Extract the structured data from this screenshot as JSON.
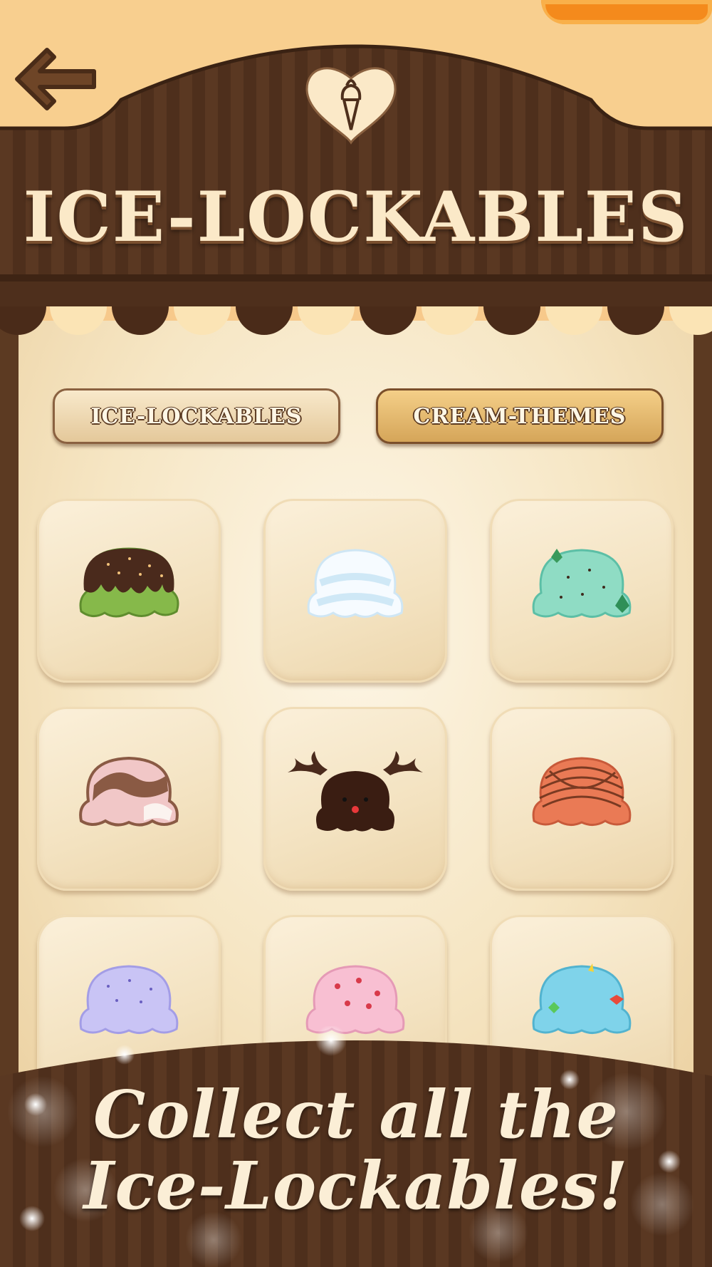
{
  "header": {
    "title": "ICE-LOCKABLES",
    "back_icon": "back-arrow-icon",
    "emblem_icon": "ice-cream-heart-icon"
  },
  "tabs": [
    {
      "label": "ICE-LOCKABLES",
      "selected": true
    },
    {
      "label": "CREAM-THEMES",
      "selected": false
    }
  ],
  "items": [
    {
      "name": "chocolate-matcha-scoop",
      "colors": [
        "#4a2a1c",
        "#86b94a"
      ]
    },
    {
      "name": "vanilla-cloud-scoop",
      "colors": [
        "#f6fbff",
        "#bfe0f2"
      ]
    },
    {
      "name": "mint-chip-scoop",
      "colors": [
        "#8fdcc4",
        "#2f8f57"
      ]
    },
    {
      "name": "neapolitan-swirl-scoop",
      "colors": [
        "#f1c7c7",
        "#8a5a44"
      ]
    },
    {
      "name": "reindeer-chocolate-scoop",
      "colors": [
        "#3a1d12",
        "#5a3620"
      ]
    },
    {
      "name": "orange-chocolate-drizzle-scoop",
      "colors": [
        "#ea7a55",
        "#7a3a22"
      ]
    },
    {
      "name": "lavender-sprinkle-scoop",
      "colors": [
        "#c9c4f5",
        "#6a5fc0"
      ]
    },
    {
      "name": "strawberry-sprinkle-scoop",
      "colors": [
        "#f8bfd2",
        "#d83a4a"
      ]
    },
    {
      "name": "blue-candy-scoop",
      "colors": [
        "#7fd3ea",
        "#e84a3a"
      ]
    }
  ],
  "caption": {
    "line1": "Collect all the",
    "line2": "Ice-Lockables!"
  },
  "palette": {
    "wood_dark": "#4e2f1c",
    "wood_light": "#6b4428",
    "cream": "#fbe9c8",
    "awning_cream": "#fbe4b5",
    "background_peach": "#f8cf8f"
  }
}
